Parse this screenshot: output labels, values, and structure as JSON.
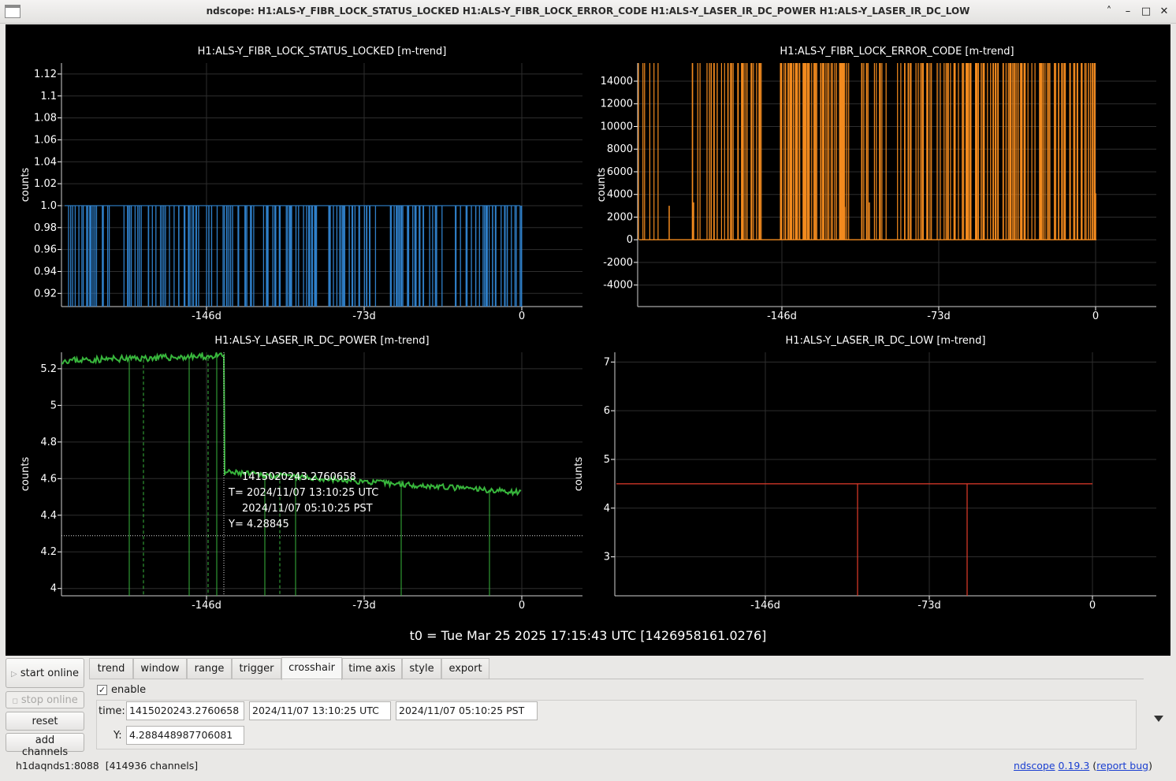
{
  "window": {
    "title": "ndscope: H1:ALS-Y_FIBR_LOCK_STATUS_LOCKED H1:ALS-Y_FIBR_LOCK_ERROR_CODE H1:ALS-Y_LASER_IR_DC_POWER H1:ALS-Y_LASER_IR_DC_LOW",
    "controls": {
      "minimize_up": "˄",
      "minimize": "–",
      "maximize": "□",
      "close": "✕"
    }
  },
  "t0_label": "t0 = Tue Mar 25 2025 17:15:43 UTC [1426958161.0276]",
  "crosshair_readout": {
    "gps": "1415020243.2760658",
    "utc": "T= 2024/11/07 13:10:25 UTC",
    "pst": "2024/11/07 05:10:25 PST",
    "y": "Y= 4.28845"
  },
  "chart_data": [
    {
      "type": "line",
      "title": "H1:ALS-Y_FIBR_LOCK_STATUS_LOCKED [m-trend]",
      "ylabel": "counts",
      "color": "#2f7fc8",
      "x_ticks": [
        "-146d",
        "-73d",
        "0"
      ],
      "y_ticks": [
        "0.92",
        "0.94",
        "0.96",
        "0.98",
        "1.0",
        "1.02",
        "1.04",
        "1.06",
        "1.08",
        "1.1",
        "1.12"
      ],
      "ylim": [
        0.908,
        1.13
      ],
      "series": [
        {
          "values_summary": {
            "baseline": 1.0,
            "dropouts_to": 0.0
          }
        }
      ]
    },
    {
      "type": "line",
      "title": "H1:ALS-Y_FIBR_LOCK_ERROR_CODE [m-trend]",
      "ylabel": "counts",
      "color": "#f28a1e",
      "x_ticks": [
        "-146d",
        "-73d",
        "0"
      ],
      "y_ticks": [
        "-4000",
        "-2000",
        "0",
        "2000",
        "4000",
        "6000",
        "8000",
        "10000",
        "12000",
        "14000"
      ],
      "ylim": [
        -5900,
        15600
      ],
      "series": [
        {
          "values_summary": {
            "baseline": 0,
            "spikes_to": 15600
          }
        }
      ]
    },
    {
      "type": "line",
      "title": "H1:ALS-Y_LASER_IR_DC_POWER [m-trend]",
      "ylabel": "counts",
      "color": "#38b63c",
      "x_ticks": [
        "-146d",
        "-73d",
        "0"
      ],
      "y_ticks": [
        "4",
        "4.2",
        "4.4",
        "4.6",
        "4.8",
        "5",
        "5.2"
      ],
      "ylim": [
        3.96,
        5.29
      ],
      "series": [
        {
          "points": [
            [
              -213,
              5.25
            ],
            [
              -146,
              5.27
            ],
            [
              -145,
              4.62
            ],
            [
              -73,
              4.6
            ],
            [
              -1,
              4.5
            ]
          ]
        }
      ]
    },
    {
      "type": "line",
      "title": "H1:ALS-Y_LASER_IR_DC_LOW [m-trend]",
      "ylabel": "counts",
      "color": "#e23b2a",
      "x_ticks": [
        "-146d",
        "-73d",
        "0"
      ],
      "y_ticks": [
        "3",
        "4",
        "5",
        "6",
        "7"
      ],
      "ylim": [
        2.2,
        7.2
      ],
      "series": [
        {
          "points": [
            [
              -186,
              4.5
            ],
            [
              -1,
              4.5
            ]
          ],
          "dropouts_at": [
            -105,
            -57
          ]
        }
      ]
    }
  ],
  "sidebar": {
    "start_online": "start online",
    "stop_online": "stop online",
    "reset": "reset",
    "add_channels": "add channels"
  },
  "tabs": [
    "trend",
    "window",
    "range",
    "trigger",
    "crosshair",
    "time axis",
    "style",
    "export"
  ],
  "active_tab": "crosshair",
  "crosshair_panel": {
    "enable_label": "enable",
    "enable_checked": "✓",
    "time_label": "time:",
    "y_label": "Y:",
    "time_gps": "1415020243.2760658",
    "time_utc": "2024/11/07 13:10:25 UTC",
    "time_pst": "2024/11/07 05:10:25 PST",
    "y_value": "4.288448987706081"
  },
  "status": {
    "server": "h1daqnds1:8088",
    "channels": "[414936 channels]",
    "app_link": "ndscope",
    "version_link": "0.19.3",
    "open_paren": " (",
    "report_link": "report bug",
    "close_paren": ")"
  }
}
